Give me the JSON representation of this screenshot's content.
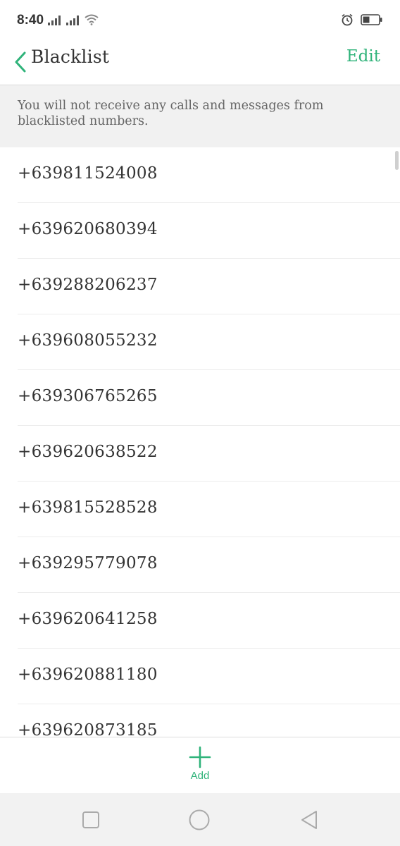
{
  "status": {
    "time": "8:40",
    "icons": [
      "signal-icon",
      "signal-icon",
      "wifi-icon",
      "alarm-icon",
      "battery-icon"
    ]
  },
  "header": {
    "title": "Blacklist",
    "edit_label": "Edit"
  },
  "info": {
    "text": "You will not receive any calls and messages from blacklisted numbers."
  },
  "numbers": [
    "+639811524008",
    "+639620680394",
    "+639288206237",
    "+639608055232",
    "+639306765265",
    "+639620638522",
    "+639815528528",
    "+639295779078",
    "+639620641258",
    "+639620881180",
    "+639620873185"
  ],
  "bottom": {
    "add_label": "Add"
  },
  "colors": {
    "accent": "#2fb37a",
    "banner_bg": "#f1f1f1"
  }
}
